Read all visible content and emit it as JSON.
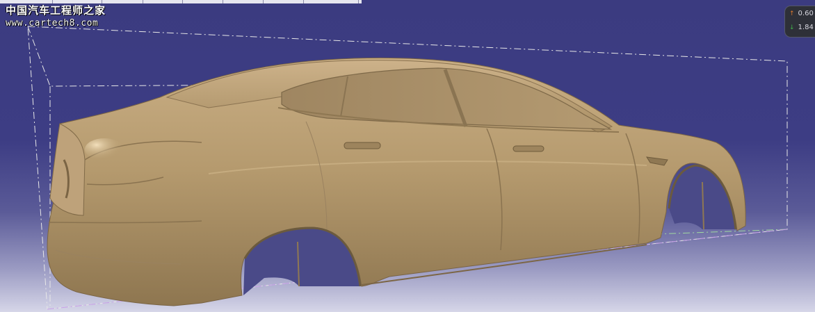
{
  "watermark": {
    "title": "中国汽车工程师之家",
    "url": "www.cartech8.com"
  },
  "info_panel": {
    "row1": {
      "value": "0.60",
      "icon": "arrow-up-icon",
      "color": "#e07a2e"
    },
    "row2": {
      "value": "1.84",
      "icon": "arrow-down-icon",
      "color": "#3fb24a"
    }
  },
  "colors": {
    "background_top": "#3b3b80",
    "background_bottom": "#d6d6e8",
    "model_body": "#b59a6e",
    "bounding_box": "#e8e8e8"
  }
}
